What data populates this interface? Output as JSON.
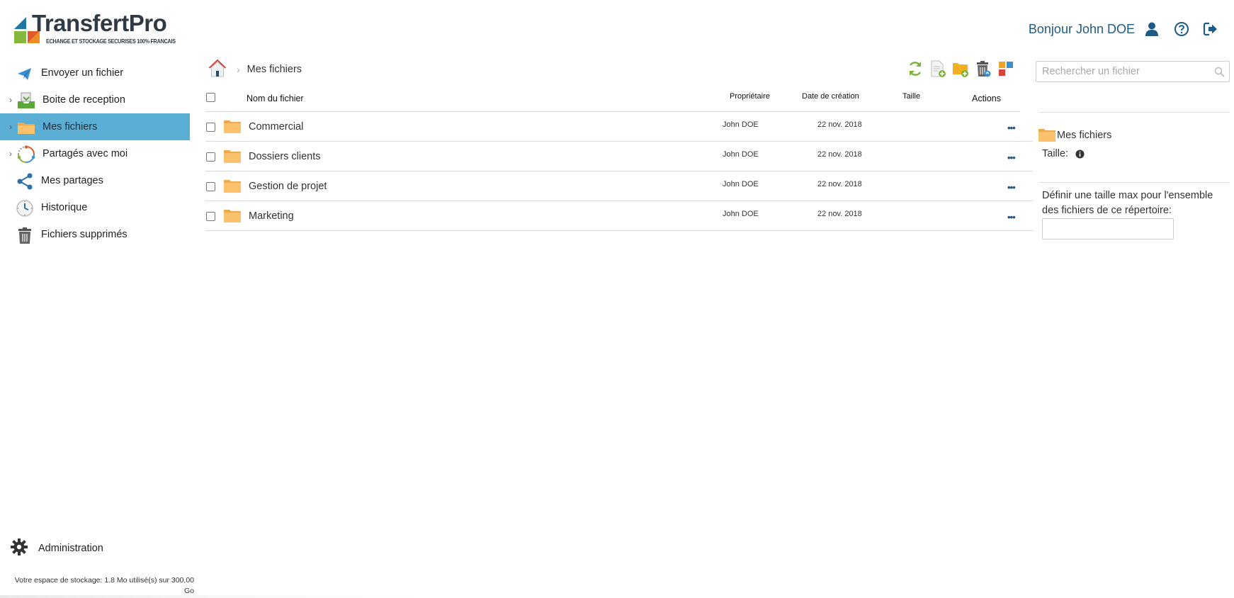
{
  "brand": {
    "name": "TransfertPro",
    "tagline": "ECHANGE ET STOCKAGE SECURISES 100% FRANCAIS",
    "colors": [
      "#1f74a8",
      "#83b83c",
      "#e05a2b",
      "#f08a22"
    ]
  },
  "header": {
    "greeting": "Bonjour John DOE",
    "icons": [
      "user-icon",
      "help-icon",
      "logout-icon"
    ],
    "accent": "#1e5a87"
  },
  "sidebar": {
    "items": [
      {
        "label": "Envoyer un fichier",
        "icon": "send-plane-icon",
        "expandable": false,
        "active": false
      },
      {
        "label": "Boite de reception",
        "icon": "inbox-tray-icon",
        "expandable": true,
        "active": false
      },
      {
        "label": "Mes fichiers",
        "icon": "folder-icon",
        "expandable": true,
        "active": true
      },
      {
        "label": "Partagés avec moi",
        "icon": "shared-cycle-icon",
        "expandable": true,
        "active": false
      },
      {
        "label": "Mes partages",
        "icon": "share-icon",
        "expandable": false,
        "active": false
      },
      {
        "label": "Historique",
        "icon": "clock-icon",
        "expandable": false,
        "active": false
      },
      {
        "label": "Fichiers supprimés",
        "icon": "trash-icon",
        "expandable": false,
        "active": false
      }
    ],
    "active_color": "#5aaed4",
    "admin_label": "Administration",
    "storage_line1": "Votre espace de stockage: 1.8 Mo utilisé(s) sur 300,00",
    "storage_line2": "Go"
  },
  "breadcrumb": {
    "current": "Mes fichiers"
  },
  "toolbar": {
    "buttons": [
      "refresh-icon",
      "new-file-icon",
      "new-folder-icon",
      "delete-icon",
      "view-toggle-icon"
    ]
  },
  "search": {
    "placeholder": "Rechercher un fichier"
  },
  "table": {
    "headers": {
      "name": "Nom du fichier",
      "owner": "Propriétaire",
      "created": "Date de création",
      "size": "Taille",
      "actions": "Actions"
    },
    "rows": [
      {
        "name": "Commercial",
        "owner": "John DOE",
        "created": "22 nov. 2018",
        "size": "",
        "actions": "•••"
      },
      {
        "name": "Dossiers clients",
        "owner": "John DOE",
        "created": "22 nov. 2018",
        "size": "",
        "actions": "•••"
      },
      {
        "name": "Gestion de projet",
        "owner": "John DOE",
        "created": "22 nov. 2018",
        "size": "",
        "actions": "•••"
      },
      {
        "name": "Marketing",
        "owner": "John DOE",
        "created": "22 nov. 2018",
        "size": "",
        "actions": "•••"
      }
    ]
  },
  "details_panel": {
    "folder_name": "Mes fichiers",
    "size_label": "Taille:",
    "max_size_label": "Définir une taille max pour l'ensemble des fichiers de ce répertoire:",
    "max_size_value": ""
  }
}
